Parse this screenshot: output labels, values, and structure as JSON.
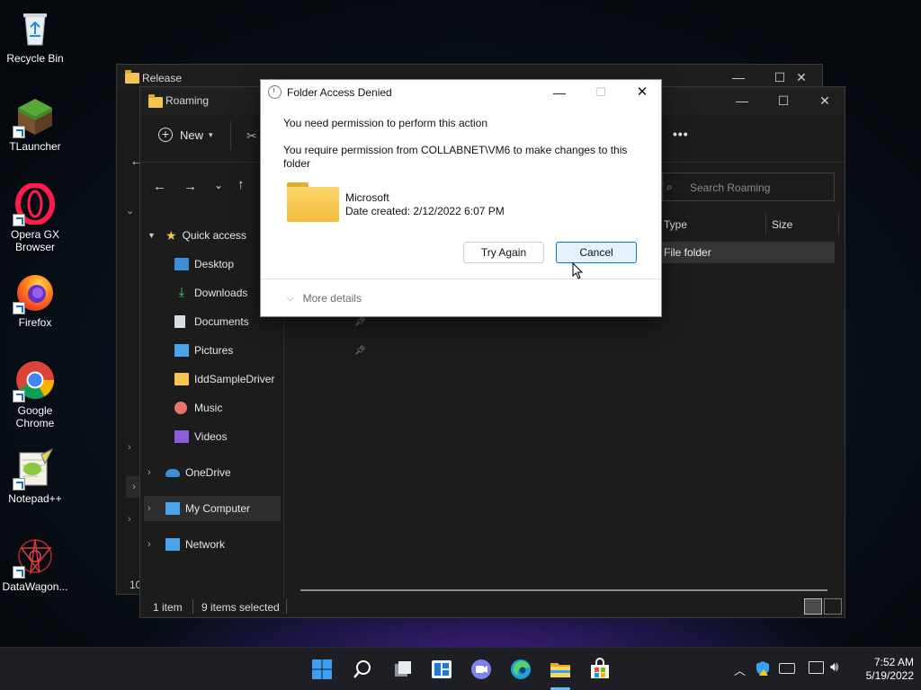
{
  "desktop": {
    "icons": [
      {
        "label": "Recycle Bin"
      },
      {
        "label": "TLauncher"
      },
      {
        "label": "Opera GX Browser"
      },
      {
        "label": "Firefox"
      },
      {
        "label": "Google Chrome"
      },
      {
        "label": "Notepad++"
      },
      {
        "label": "DataWagon..."
      }
    ]
  },
  "back_window": {
    "title": "Release",
    "partial_status": "10"
  },
  "explorer": {
    "title": "Roaming",
    "toolbar": {
      "new_label": "New",
      "more_label": "•••"
    },
    "search_placeholder": "Search Roaming",
    "columns": {
      "type": "Type",
      "size": "Size"
    },
    "row": {
      "type": "File folder"
    },
    "nav": {
      "quick_access": "Quick access",
      "items": [
        {
          "label": "Desktop",
          "pinned": false
        },
        {
          "label": "Downloads",
          "pinned": false
        },
        {
          "label": "Documents",
          "pinned": true
        },
        {
          "label": "Pictures",
          "pinned": true
        },
        {
          "label": "IddSampleDriver",
          "pinned": false
        },
        {
          "label": "Music",
          "pinned": false
        },
        {
          "label": "Videos",
          "pinned": false
        }
      ],
      "onedrive": "OneDrive",
      "my_computer": "My Computer",
      "network": "Network"
    },
    "status": {
      "items": "1 item",
      "selected": "9 items selected"
    }
  },
  "dialog": {
    "title": "Folder Access Denied",
    "message1": "You need permission to perform this action",
    "message2": "You require permission from COLLABNET\\VM6 to make changes to this folder",
    "folder_name": "Microsoft",
    "date_created": "Date created: 2/12/2022 6:07 PM",
    "try_again": "Try Again",
    "cancel": "Cancel",
    "more_details": "More details"
  },
  "taskbar": {
    "time": "7:52 AM",
    "date": "5/19/2022"
  },
  "colors": {
    "accent": "#0078d4",
    "folder_yellow": "#f5c451",
    "dark_bg": "#1c1c1c",
    "dialog_bg": "#ffffff"
  }
}
